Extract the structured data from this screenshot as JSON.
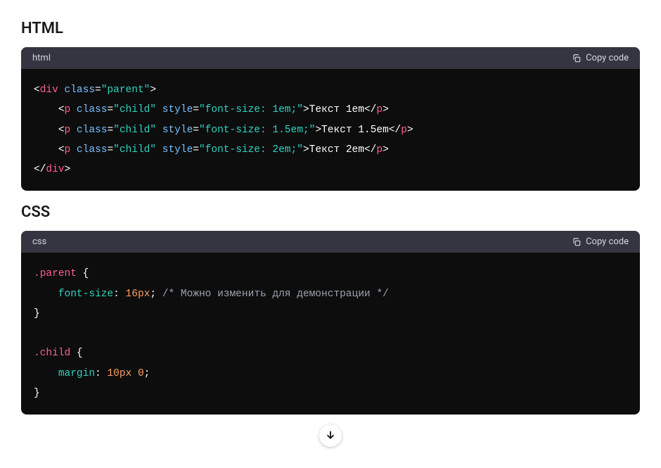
{
  "sections": {
    "html": {
      "heading": "HTML",
      "lang_label": "html",
      "copy_label": "Copy code",
      "code": {
        "line1": {
          "open": "<",
          "div": "div",
          "sp": " ",
          "class": "class",
          "eq": "=",
          "val": "\"parent\"",
          "close": ">"
        },
        "line2": {
          "indent": "    ",
          "open": "<",
          "p": "p",
          "sp1": " ",
          "class": "class",
          "eq1": "=",
          "cval": "\"child\"",
          "sp2": " ",
          "style": "style",
          "eq2": "=",
          "sval": "\"font-size: 1em;\"",
          "close1": ">",
          "text": "Текст 1em",
          "open2": "</",
          "p2": "p",
          "close2": ">"
        },
        "line3": {
          "indent": "    ",
          "open": "<",
          "p": "p",
          "sp1": " ",
          "class": "class",
          "eq1": "=",
          "cval": "\"child\"",
          "sp2": " ",
          "style": "style",
          "eq2": "=",
          "sval": "\"font-size: 1.5em;\"",
          "close1": ">",
          "text": "Текст 1.5em",
          "open2": "</",
          "p2": "p",
          "close2": ">"
        },
        "line4": {
          "indent": "    ",
          "open": "<",
          "p": "p",
          "sp1": " ",
          "class": "class",
          "eq1": "=",
          "cval": "\"child\"",
          "sp2": " ",
          "style": "style",
          "eq2": "=",
          "sval": "\"font-size: 2em;\"",
          "close1": ">",
          "text": "Текст 2em",
          "open2": "</",
          "p2": "p",
          "close2": ">"
        },
        "line5": {
          "open": "</",
          "div": "div",
          "close": ">"
        }
      }
    },
    "css": {
      "heading": "CSS",
      "lang_label": "css",
      "copy_label": "Copy code",
      "code": {
        "line1": {
          "sel": ".parent",
          "sp": " ",
          "brace": "{"
        },
        "line2": {
          "indent": "    ",
          "prop": "font-size",
          "colon": ": ",
          "val": "16px",
          "semi": ";",
          "sp": " ",
          "comment": "/* Можно изменить для демонстрации */"
        },
        "line3": {
          "brace": "}"
        },
        "line4": {
          "blank": ""
        },
        "line5": {
          "sel": ".child",
          "sp": " ",
          "brace": "{"
        },
        "line6": {
          "indent": "    ",
          "prop": "margin",
          "colon": ": ",
          "val": "10px",
          "sp": " ",
          "val2": "0",
          "semi": ";"
        },
        "line7": {
          "brace": "}"
        }
      }
    }
  }
}
